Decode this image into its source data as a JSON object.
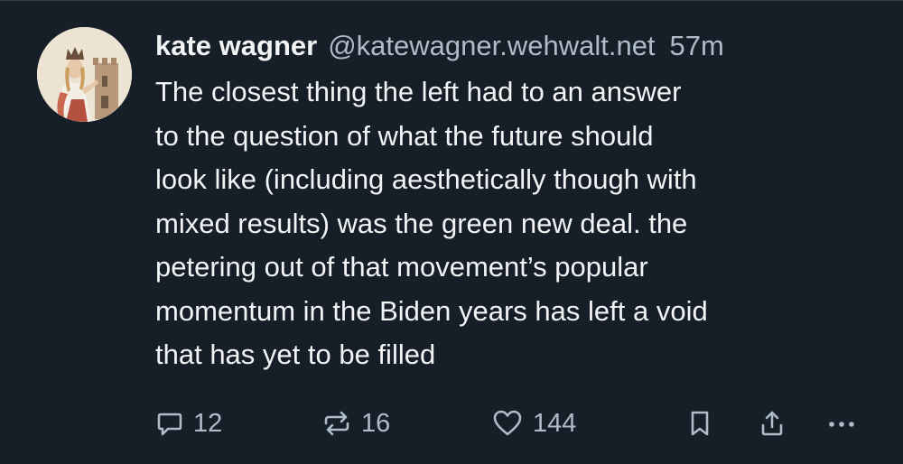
{
  "post": {
    "author": {
      "display_name": "kate wagner",
      "handle": "@katewagner.wehwalt.net",
      "avatar_icon": "avatar-medieval-woman-with-tower"
    },
    "separator": " ",
    "timestamp": "57m",
    "text_lines": [
      "The closest thing the left had to an answer",
      "to the question of what the future should",
      "look like (including aesthetically though with",
      "mixed results) was the green new deal. the",
      "petering out of that movement’s popular",
      "momentum in the Biden years has left a void",
      "that has yet to be filled"
    ],
    "actions": {
      "reply": {
        "icon": "speech-bubble-icon",
        "count": "12"
      },
      "repost": {
        "icon": "repost-arrows-icon",
        "count": "16"
      },
      "like": {
        "icon": "heart-icon",
        "count": "144"
      },
      "bookmark": {
        "icon": "bookmark-icon"
      },
      "share": {
        "icon": "share-icon"
      },
      "more": {
        "icon": "ellipsis-icon"
      }
    }
  },
  "colors": {
    "background": "#161e27",
    "primary_text": "#f1f3f5",
    "secondary_text": "#aebbc9",
    "divider": "#2e3b47"
  }
}
